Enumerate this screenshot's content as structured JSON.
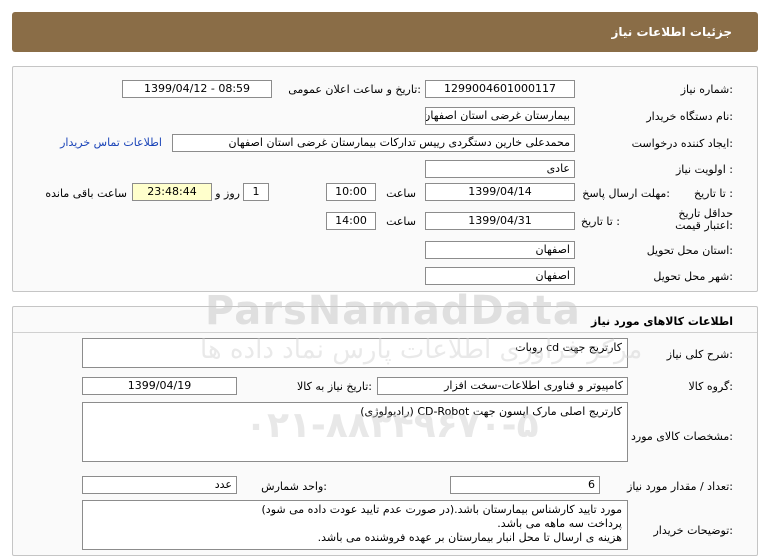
{
  "header": {
    "title": "جزئیات اطلاعات نیاز"
  },
  "info": {
    "need_number_label": "شماره نیاز:",
    "need_number": "1299004601000117",
    "announce_label": "تاریخ و ساعت اعلان عمومی:",
    "announce_value": "1399/04/12 - 08:59",
    "buyer_label": "نام دستگاه خریدار:",
    "buyer_value": "بیمارستان غرضی استان اصفهان",
    "creator_label": "ایجاد کننده درخواست:",
    "creator_value": "محمدعلی خارین دستگردی رییس تدارکات بیمارستان غرضی استان اصفهان",
    "contact_link": "اطلاعات تماس خریدار",
    "priority_label": "اولویت نیاز :",
    "priority_value": "عادی",
    "deadline_label": "مهلت ارسال پاسخ:",
    "to_date_label": "تا تاریخ :",
    "deadline_date": "1399/04/14",
    "time_label": "ساعت",
    "deadline_time": "10:00",
    "days_value": "1",
    "days_label": "روز و",
    "remaining_time": "23:48:44",
    "remaining_label": "ساعت باقی مانده",
    "validity_label": "حداقل تاریخ اعتبار قیمت:",
    "validity_date": "1399/04/31",
    "validity_time": "14:00",
    "province_label": "استان محل تحویل:",
    "province_value": "اصفهان",
    "city_label": "شهر محل تحویل:",
    "city_value": "اصفهان"
  },
  "goods": {
    "title": "اطلاعات کالاهای مورد نیاز",
    "desc_label": "شرح کلی نیاز:",
    "desc_value": "کارتریج جهت cd روبات",
    "group_label": "گروه کالا:",
    "group_value": "کامپیوتر و فناوری اطلاعات-سخت افزار",
    "need_date_label": "تاریخ نیاز به کالا:",
    "need_date": "1399/04/19",
    "specs_label": "مشخصات کالای مورد نیاز:",
    "specs_value": "کارتریج اصلی مارک اپسون جهت CD-Robot (رادیولوژی)",
    "qty_label": "تعداد / مقدار مورد نیاز:",
    "qty_value": "6",
    "unit_label": "واحد شمارش:",
    "unit_value": "عدد",
    "buyer_notes_label": "توضیحات خریدار:",
    "buyer_notes": [
      "مورد تایید کارشناس بیمارستان باشد.(در صورت عدم تایید عودت داده می شود)",
      "پرداخت سه ماهه می باشد.",
      "هزینه ی ارسال تا محل انبار بیمارستان بر عهده فروشنده می باشد."
    ]
  },
  "watermark": {
    "line1": "ParsNamadData",
    "line2": "مرکز فراوری اطلاعات پارس نماد داده ها",
    "line3": "۰۲۱-۸۸۳۴۹۶۷۰-۵"
  }
}
